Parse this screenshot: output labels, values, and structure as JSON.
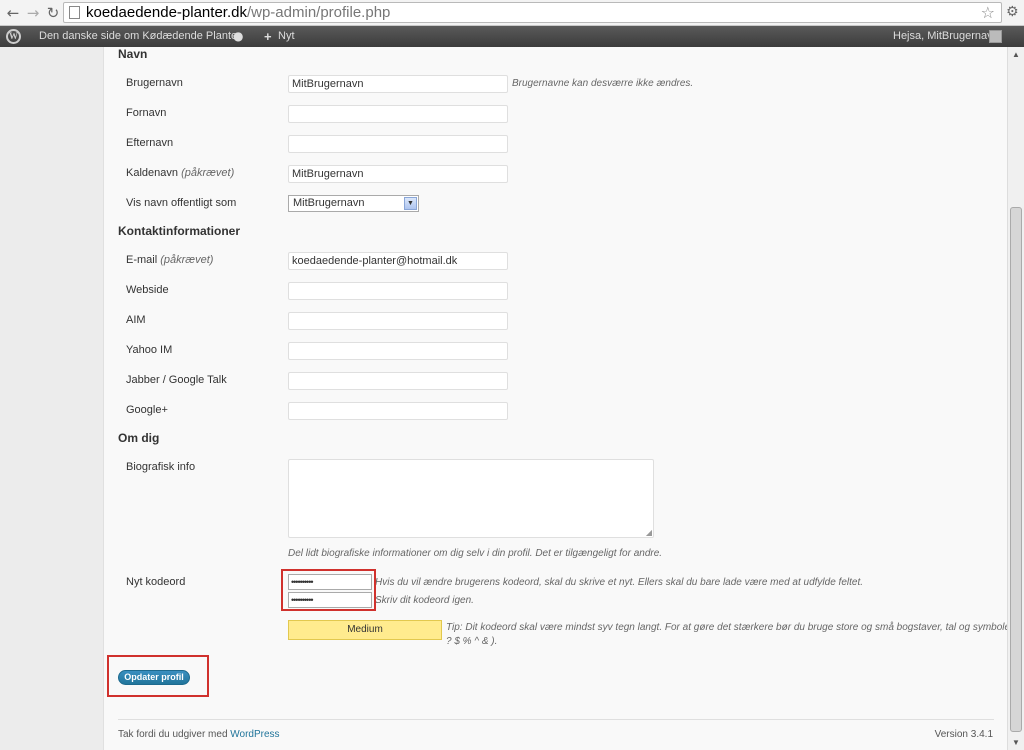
{
  "browser": {
    "url_domain": "koedaedende-planter.dk",
    "url_path": "/wp-admin/profile.php"
  },
  "admin_bar": {
    "site_name": "Den danske side om Kødædende Planter",
    "new_label": "Nyt",
    "greeting": "Hejsa, MitBrugernavn"
  },
  "sections": {
    "name": "Navn",
    "contact": "Kontaktinformationer",
    "about": "Om dig"
  },
  "fields": {
    "username_label": "Brugernavn",
    "username_value": "MitBrugernavn",
    "username_desc": "Brugernavne kan desværre ikke ændres.",
    "firstname_label": "Fornavn",
    "lastname_label": "Efternavn",
    "nickname_label": "Kaldenavn",
    "nickname_required": "(påkrævet)",
    "nickname_value": "MitBrugernavn",
    "display_label": "Vis navn offentligt som",
    "display_value": "MitBrugernavn",
    "email_label": "E-mail",
    "email_required": "(påkrævet)",
    "email_value": "koedaedende-planter@hotmail.dk",
    "website_label": "Webside",
    "aim_label": "AIM",
    "yahoo_label": "Yahoo IM",
    "jabber_label": "Jabber / Google Talk",
    "google_label": "Google+",
    "bio_label": "Biografisk info",
    "bio_desc": "Del lidt biografiske informationer om dig selv i din profil. Det er tilgængeligt for andre.",
    "password_label": "Nyt kodeord",
    "password_value": "••••••••••",
    "password_confirm_value": "••••••••••",
    "password_desc": "Hvis du vil ændre brugerens kodeord, skal du skrive et nyt. Ellers skal du bare lade være med at udfylde feltet.",
    "password_confirm_desc": "Skriv dit kodeord igen.",
    "strength_label": "Medium",
    "hint_line1": "Tip: Dit kodeord skal være mindst syv tegn langt. For at gøre det stærkere bør du bruge store og små bogstaver, tal og symboler som ! \"",
    "hint_line2": "? $ % ^ & )."
  },
  "actions": {
    "update_label": "Opdater profil"
  },
  "footer": {
    "thanks": "Tak fordi du udgiver med ",
    "wp_link": "WordPress",
    "version": "Version 3.4.1"
  },
  "colors": {
    "highlight": "#d0312d",
    "button": "#21759b",
    "strength_bg": "#ffeb8e"
  }
}
